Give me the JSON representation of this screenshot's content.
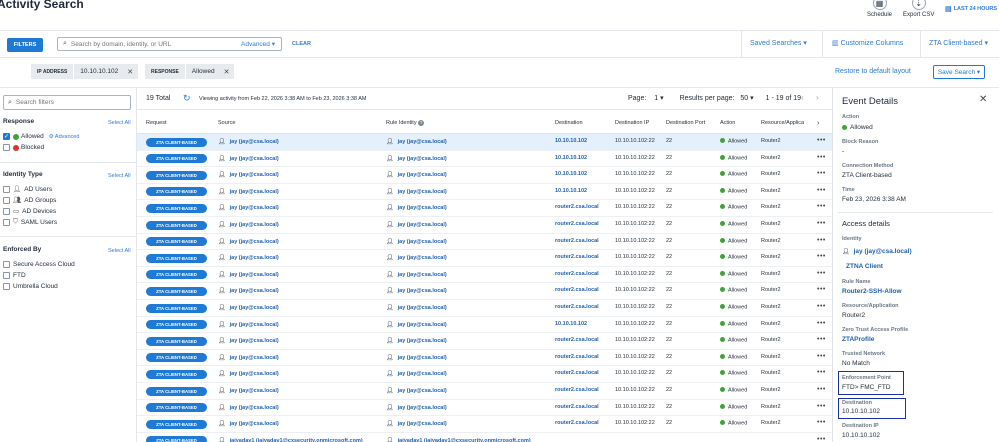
{
  "header": {
    "title": "Activity Search",
    "schedule_label": "Schedule",
    "export_label": "Export CSV",
    "time_range": "LAST 24 HOURS"
  },
  "toolbar": {
    "filters_label": "FILTERS",
    "search_placeholder": "Search by domain, identity, or URL",
    "advanced_label": "Advanced",
    "clear_label": "CLEAR",
    "saved_searches_label": "Saved Searches",
    "customize_columns_label": "Customize Columns",
    "zta_label": "ZTA Client-based"
  },
  "chips": [
    {
      "key": "IP ADDRESS",
      "value": "10.10.10.102"
    },
    {
      "key": "RESPONSE",
      "value": "Allowed"
    }
  ],
  "layout_actions": {
    "restore_label": "Restore to default layout",
    "save_search_label": "Save Search"
  },
  "filters": {
    "search_placeholder": "Search filters",
    "select_all": "Select All",
    "response": {
      "title": "Response",
      "advanced": "Advanced",
      "options": [
        {
          "label": "Allowed",
          "checked": true,
          "color": "#3fa33a"
        },
        {
          "label": "Blocked",
          "checked": false,
          "color": "#d9342b"
        }
      ]
    },
    "identity_type": {
      "title": "Identity Type",
      "options": [
        {
          "label": "AD Users",
          "icon": "user-icon"
        },
        {
          "label": "AD Groups",
          "icon": "group-icon"
        },
        {
          "label": "AD Devices",
          "icon": "device-icon"
        },
        {
          "label": "SAML Users",
          "icon": "shield-user-icon"
        }
      ]
    },
    "enforced_by": {
      "title": "Enforced By",
      "options": [
        {
          "label": "Secure Access Cloud"
        },
        {
          "label": "FTD"
        },
        {
          "label": "Umbrella Cloud"
        }
      ]
    }
  },
  "results": {
    "total": "19 Total",
    "viewing": "Viewing activity from Feb 22, 2026 3:38 AM to Feb 23, 2026 3:38 AM",
    "page_label": "Page:",
    "page_value": "1",
    "per_page_label": "Results per page:",
    "per_page_value": "50",
    "range": "1 - 19 of 19",
    "columns": [
      "Request",
      "Source",
      "Rule Identity",
      "Destination",
      "Destination IP",
      "Destination Port",
      "Action",
      "Resource/Applica"
    ],
    "rows": [
      {
        "request": "ZTA CLIENT-BASED",
        "source": "jay (jay@csa.local)",
        "rule_identity": "jay (jay@csa.local)",
        "destination": "10.10.10.102",
        "dest_ip": "10.10.10.102:22",
        "dest_port": "22",
        "action": "Allowed",
        "resource": "Router2"
      },
      {
        "request": "ZTA CLIENT-BASED",
        "source": "jay (jay@csa.local)",
        "rule_identity": "jay (jay@csa.local)",
        "destination": "10.10.10.102",
        "dest_ip": "10.10.10.102:22",
        "dest_port": "22",
        "action": "Allowed",
        "resource": "Router2"
      },
      {
        "request": "ZTA CLIENT-BASED",
        "source": "jay (jay@csa.local)",
        "rule_identity": "jay (jay@csa.local)",
        "destination": "10.10.10.102",
        "dest_ip": "10.10.10.102:22",
        "dest_port": "22",
        "action": "Allowed",
        "resource": "Router2"
      },
      {
        "request": "ZTA CLIENT-BASED",
        "source": "jay (jay@csa.local)",
        "rule_identity": "jay (jay@csa.local)",
        "destination": "10.10.10.102",
        "dest_ip": "10.10.10.102:22",
        "dest_port": "22",
        "action": "Allowed",
        "resource": "Router2"
      },
      {
        "request": "ZTA CLIENT-BASED",
        "source": "jay (jay@csa.local)",
        "rule_identity": "jay (jay@csa.local)",
        "destination": "router2.csa.local",
        "dest_ip": "10.10.10.102:22",
        "dest_port": "22",
        "action": "Allowed",
        "resource": "Router2"
      },
      {
        "request": "ZTA CLIENT-BASED",
        "source": "jay (jay@csa.local)",
        "rule_identity": "jay (jay@csa.local)",
        "destination": "router2.csa.local",
        "dest_ip": "10.10.10.102:22",
        "dest_port": "22",
        "action": "Allowed",
        "resource": "Router2"
      },
      {
        "request": "ZTA CLIENT-BASED",
        "source": "jay (jay@csa.local)",
        "rule_identity": "jay (jay@csa.local)",
        "destination": "router2.csa.local",
        "dest_ip": "10.10.10.102:22",
        "dest_port": "22",
        "action": "Allowed",
        "resource": "Router2"
      },
      {
        "request": "ZTA CLIENT-BASED",
        "source": "jay (jay@csa.local)",
        "rule_identity": "jay (jay@csa.local)",
        "destination": "router2.csa.local",
        "dest_ip": "10.10.10.102:22",
        "dest_port": "22",
        "action": "Allowed",
        "resource": "Router2"
      },
      {
        "request": "ZTA CLIENT-BASED",
        "source": "jay (jay@csa.local)",
        "rule_identity": "jay (jay@csa.local)",
        "destination": "router2.csa.local",
        "dest_ip": "10.10.10.102:22",
        "dest_port": "22",
        "action": "Allowed",
        "resource": "Router2"
      },
      {
        "request": "ZTA CLIENT-BASED",
        "source": "jay (jay@csa.local)",
        "rule_identity": "jay (jay@csa.local)",
        "destination": "router2.csa.local",
        "dest_ip": "10.10.10.102:22",
        "dest_port": "22",
        "action": "Allowed",
        "resource": "Router2"
      },
      {
        "request": "ZTA CLIENT-BASED",
        "source": "jay (jay@csa.local)",
        "rule_identity": "jay (jay@csa.local)",
        "destination": "router2.csa.local",
        "dest_ip": "10.10.10.102:22",
        "dest_port": "22",
        "action": "Allowed",
        "resource": "Router2"
      },
      {
        "request": "ZTA CLIENT-BASED",
        "source": "jay (jay@csa.local)",
        "rule_identity": "jay (jay@csa.local)",
        "destination": "10.10.10.102",
        "dest_ip": "10.10.10.102:22",
        "dest_port": "22",
        "action": "Allowed",
        "resource": "Router2"
      },
      {
        "request": "ZTA CLIENT-BASED",
        "source": "jay (jay@csa.local)",
        "rule_identity": "jay (jay@csa.local)",
        "destination": "router2.csa.local",
        "dest_ip": "10.10.10.102:22",
        "dest_port": "22",
        "action": "Allowed",
        "resource": "Router2"
      },
      {
        "request": "ZTA CLIENT-BASED",
        "source": "jay (jay@csa.local)",
        "rule_identity": "jay (jay@csa.local)",
        "destination": "router2.csa.local",
        "dest_ip": "10.10.10.102:22",
        "dest_port": "22",
        "action": "Allowed",
        "resource": "Router2"
      },
      {
        "request": "ZTA CLIENT-BASED",
        "source": "jay (jay@csa.local)",
        "rule_identity": "jay (jay@csa.local)",
        "destination": "router2.csa.local",
        "dest_ip": "10.10.10.102:22",
        "dest_port": "22",
        "action": "Allowed",
        "resource": "Router2"
      },
      {
        "request": "ZTA CLIENT-BASED",
        "source": "jay (jay@csa.local)",
        "rule_identity": "jay (jay@csa.local)",
        "destination": "router2.csa.local",
        "dest_ip": "10.10.10.102:22",
        "dest_port": "22",
        "action": "Allowed",
        "resource": "Router2"
      },
      {
        "request": "ZTA CLIENT-BASED",
        "source": "jay (jay@csa.local)",
        "rule_identity": "jay (jay@csa.local)",
        "destination": "router2.csa.local",
        "dest_ip": "10.10.10.102:22",
        "dest_port": "22",
        "action": "Allowed",
        "resource": "Router2"
      },
      {
        "request": "ZTA CLIENT-BASED",
        "source": "jay (jay@csa.local)",
        "rule_identity": "jay (jay@csa.local)",
        "destination": "router2.csa.local",
        "dest_ip": "10.10.10.102:22",
        "dest_port": "22",
        "action": "Allowed",
        "resource": "Router2"
      },
      {
        "request": "ZTA CLIENT-BASED",
        "source": "jaiyadav1 (jaiyadav1@cxsecurity.onmicrosoft.com)",
        "rule_identity": "jaiyadav1 (jaiyadav1@cxsecurity.onmicrosoft.com)",
        "destination": "",
        "dest_ip": "",
        "dest_port": "",
        "action": "",
        "resource": ""
      }
    ]
  },
  "details": {
    "title": "Event Details",
    "action_label": "Action",
    "action_value": "Allowed",
    "block_reason_label": "Block Reason",
    "block_reason_value": "-",
    "connection_method_label": "Connection Method",
    "connection_method_value": "ZTA Client-based",
    "time_label": "Time",
    "time_value": "Feb 23, 2026 3:38 AM",
    "access_details_title": "Access details",
    "identity_label": "Identity",
    "identity_value": "jay (jay@csa.local)",
    "identity_type_value": "ZTNA Client",
    "rule_name_label": "Rule Name",
    "rule_name_value": "Router2-SSH-Allow",
    "resource_label": "Resource/Application",
    "resource_value": "Router2",
    "zta_profile_label": "Zero Trust Access Profile",
    "zta_profile_value": "ZTAProfile",
    "trusted_network_label": "Trusted Network",
    "trusted_network_value": "No Match",
    "enforcement_label": "Enforcement Point",
    "enforcement_value": "FTD> FMC_FTD",
    "destination_label": "Destination",
    "destination_value": "10.10.10.102",
    "destination_ip_label": "Destination IP",
    "destination_ip_value": "10.10.10.102"
  },
  "colors": {
    "accent": "#1f7ad6",
    "link": "#1f5fae",
    "allowed": "#3fa33a",
    "blocked": "#d9342b",
    "selected_row": "#e4f0fb",
    "highlight_box": "#1a2fb0"
  }
}
